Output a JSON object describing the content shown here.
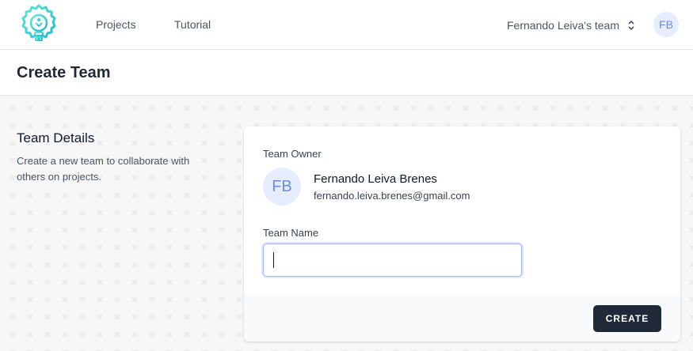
{
  "nav": {
    "links": [
      {
        "label": "Projects"
      },
      {
        "label": "Tutorial"
      }
    ],
    "team_switcher": {
      "label": "Fernando Leiva's team",
      "icon": "chevron-updown-icon"
    },
    "user_avatar": {
      "initials": "FB"
    },
    "logo": {
      "icon": "lightbulb-gear-logo"
    }
  },
  "page": {
    "title": "Create Team"
  },
  "section": {
    "heading": "Team Details",
    "description": "Create a new team to collaborate with others on projects."
  },
  "form": {
    "owner_label": "Team Owner",
    "owner": {
      "initials": "FB",
      "name": "Fernando Leiva Brenes",
      "email": "fernando.leiva.brenes@gmail.com"
    },
    "team_name_label": "Team Name",
    "team_name_value": "",
    "create_label": "CREATE"
  },
  "colors": {
    "accent": "#1f2937",
    "logo_teal": "#2ec4b6",
    "avatar_bg": "#e5edff",
    "avatar_text": "#6b8ce6",
    "input_focus": "#a5b4fc"
  }
}
